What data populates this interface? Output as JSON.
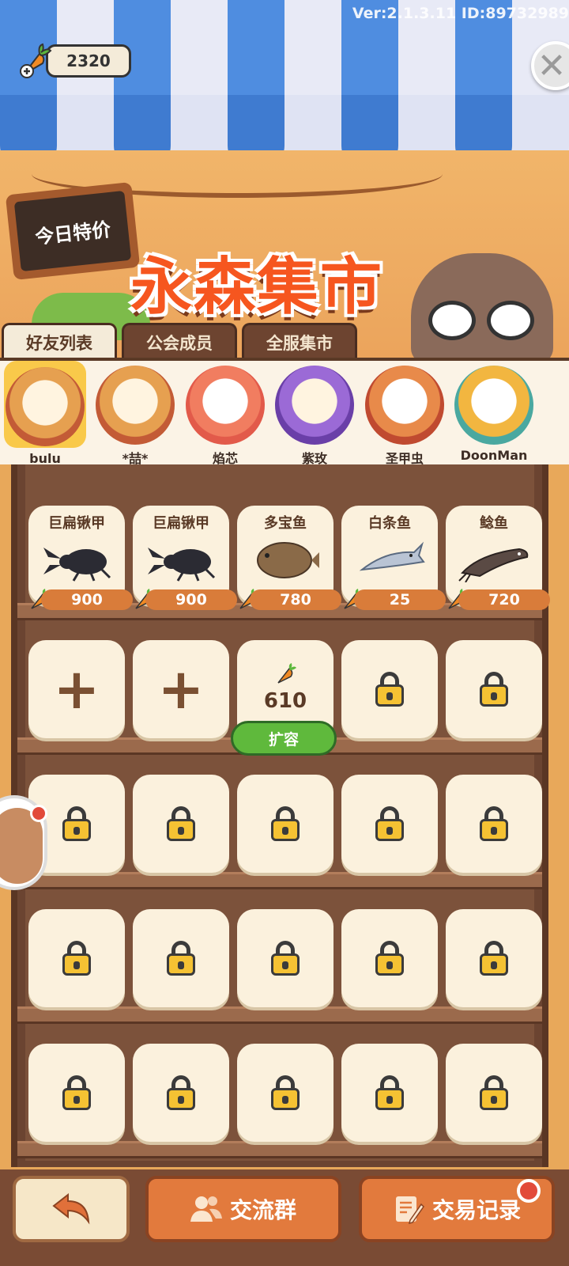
{
  "header": {
    "version_text": "Ver:2.1.3.11 ID:89732989",
    "currency": {
      "amount": "2320",
      "icon": "carrot-icon"
    },
    "sign_text": "今日特价",
    "market_title": "永森集市"
  },
  "tabs": [
    {
      "label": "好友列表",
      "active": true
    },
    {
      "label": "公会成员",
      "active": false
    },
    {
      "label": "全服集市",
      "active": false
    }
  ],
  "friends": [
    {
      "name": "bulu",
      "selected": true
    },
    {
      "name": "*喆*",
      "selected": false
    },
    {
      "name": "焰芯",
      "selected": false
    },
    {
      "name": "紫玫",
      "selected": false
    },
    {
      "name": "圣甲虫",
      "selected": false
    },
    {
      "name": "DoonMan",
      "selected": false
    }
  ],
  "shelf": {
    "items": [
      {
        "name": "巨扁锹甲",
        "price": "900",
        "art": "beetle-icon"
      },
      {
        "name": "巨扁锹甲",
        "price": "900",
        "art": "beetle-icon"
      },
      {
        "name": "多宝鱼",
        "price": "780",
        "art": "flatfish-icon"
      },
      {
        "name": "白条鱼",
        "price": "25",
        "art": "whitefish-icon"
      },
      {
        "name": "鲶鱼",
        "price": "720",
        "art": "catfish-icon"
      }
    ],
    "expand": {
      "price": "610",
      "button_label": "扩容"
    }
  },
  "bottom": {
    "group_label": "交流群",
    "trade_label": "交易记录"
  },
  "colors": {
    "accent": "#e27a3d",
    "expand_green": "#5fb93c",
    "lock_yellow": "#f5c233"
  }
}
